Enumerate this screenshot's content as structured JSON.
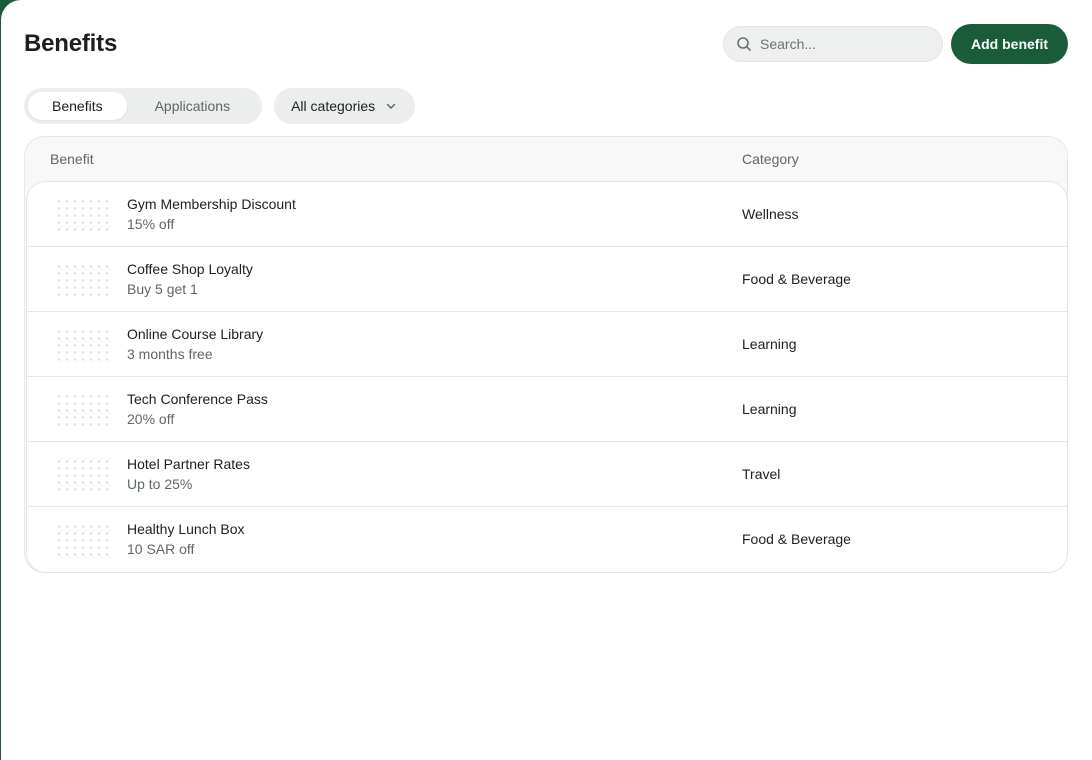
{
  "header": {
    "title": "Benefits",
    "search_placeholder": "Search...",
    "add_button_label": "Add benefit"
  },
  "tabs": [
    {
      "label": "Benefits",
      "active": true
    },
    {
      "label": "Applications",
      "active": false
    }
  ],
  "category_filter": {
    "selected": "All categories"
  },
  "table": {
    "columns": {
      "benefit": "Benefit",
      "category": "Category"
    },
    "rows": [
      {
        "name": "Gym Membership Discount",
        "detail": "15% off",
        "category": "Wellness"
      },
      {
        "name": "Coffee Shop Loyalty",
        "detail": "Buy 5 get 1",
        "category": "Food & Beverage"
      },
      {
        "name": "Online Course Library",
        "detail": "3 months free",
        "category": "Learning"
      },
      {
        "name": "Tech Conference Pass",
        "detail": "20% off",
        "category": "Learning"
      },
      {
        "name": "Hotel Partner Rates",
        "detail": "Up to 25%",
        "category": "Travel"
      },
      {
        "name": "Healthy Lunch Box",
        "detail": "10 SAR off",
        "category": "Food & Beverage"
      }
    ]
  },
  "icons": {
    "search": "search-icon",
    "dropdown": "chevron-down-icon",
    "thumbnail": "benefit-pattern-thumbnail"
  },
  "colors": {
    "brand": "#1a5c3a",
    "surface": "#f7f8f7",
    "muted_text": "#5e6863"
  }
}
